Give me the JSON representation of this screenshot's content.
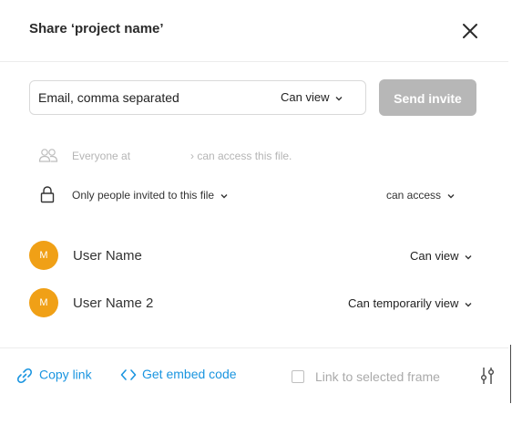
{
  "dialog": {
    "title": "Share ‘project name’"
  },
  "invite": {
    "email_placeholder": "Email, comma separated",
    "permission": "Can view",
    "send_label": "Send invite"
  },
  "access": {
    "everyone_prefix": "Everyone at",
    "everyone_suffix": "› can access this file.",
    "restriction": "Only people invited to this file",
    "level": "can access"
  },
  "users": [
    {
      "avatar_initial": "M",
      "name": "User Name",
      "permission": "Can view",
      "avatar_color": "#f0a016"
    },
    {
      "avatar_initial": "M",
      "name": "User Name 2",
      "permission": "Can temporarily view",
      "avatar_color": "#f0a016"
    }
  ],
  "footer": {
    "copy_link": "Copy link",
    "embed_code": "Get embed code",
    "selected_frame_label": "Link to selected frame",
    "selected_frame_checked": false
  },
  "colors": {
    "accent": "#1a95e0",
    "avatar": "#f0a016",
    "send_button_disabled": "#b7b7b7"
  },
  "icons": [
    "close-icon",
    "chevron-down-icon",
    "people-icon",
    "lock-icon",
    "link-icon",
    "code-icon",
    "settings-sliders-icon"
  ]
}
